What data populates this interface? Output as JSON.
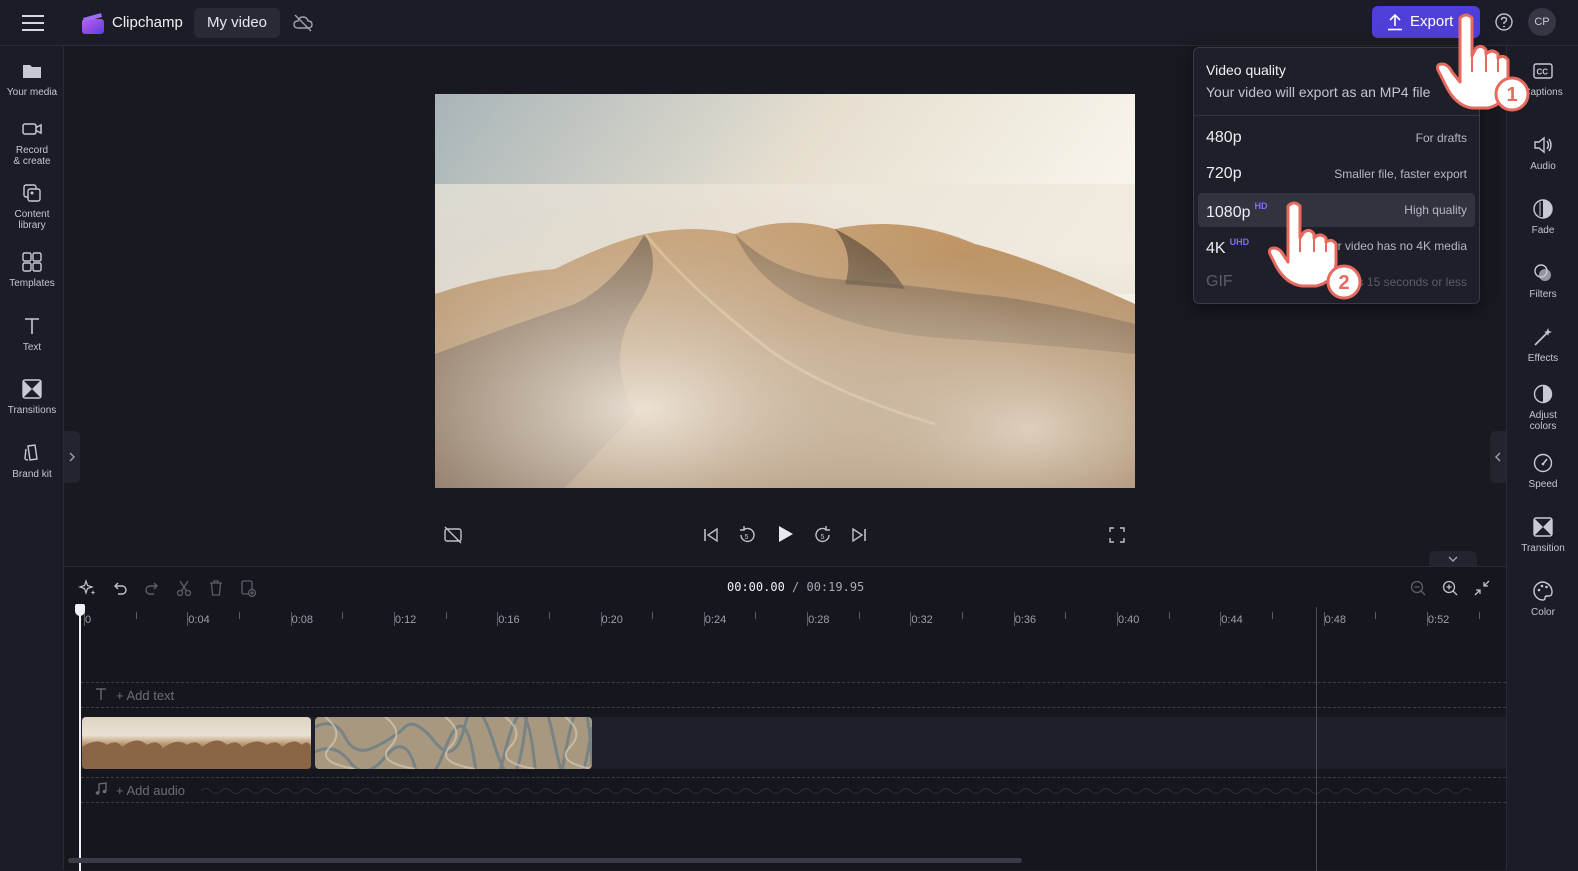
{
  "header": {
    "brand": "Clipchamp",
    "video_title": "My video",
    "export_label": "Export",
    "avatar_initials": "CP"
  },
  "left_sidebar": {
    "items": [
      {
        "label": "Your media",
        "icon": "folder-icon"
      },
      {
        "label": "Record & create",
        "icon": "camera-icon"
      },
      {
        "label": "Content library",
        "icon": "library-icon"
      },
      {
        "label": "Templates",
        "icon": "templates-icon"
      },
      {
        "label": "Text",
        "icon": "text-icon"
      },
      {
        "label": "Transitions",
        "icon": "transitions-icon"
      },
      {
        "label": "Brand kit",
        "icon": "brand-kit-icon"
      }
    ]
  },
  "right_sidebar": {
    "items": [
      {
        "label": "Captions",
        "icon": "captions-icon"
      },
      {
        "label": "Audio",
        "icon": "speaker-icon"
      },
      {
        "label": "Fade",
        "icon": "fade-icon"
      },
      {
        "label": "Filters",
        "icon": "filters-icon"
      },
      {
        "label": "Effects",
        "icon": "magic-wand-icon"
      },
      {
        "label": "Adjust colors",
        "icon": "contrast-icon"
      },
      {
        "label": "Speed",
        "icon": "speedometer-icon"
      },
      {
        "label": "Transition",
        "icon": "transition-icon"
      },
      {
        "label": "Color",
        "icon": "palette-icon"
      }
    ]
  },
  "export_menu": {
    "title": "Video quality",
    "subtitle": "Your video will export as an MP4 file",
    "options": [
      {
        "quality": "480p",
        "badge": "",
        "desc": "For drafts",
        "selected": false,
        "disabled": false
      },
      {
        "quality": "720p",
        "badge": "",
        "desc": "Smaller file, faster export",
        "selected": false,
        "disabled": false
      },
      {
        "quality": "1080p",
        "badge": "HD",
        "desc": "High quality",
        "selected": true,
        "disabled": false
      },
      {
        "quality": "4K",
        "badge": "UHD",
        "desc": "Your video has no 4K media",
        "selected": false,
        "disabled": false
      },
      {
        "quality": "GIF",
        "badge": "",
        "desc": "For videos 15 seconds or less",
        "selected": false,
        "disabled": true
      }
    ]
  },
  "annotations": {
    "step1": "1",
    "step2": "2"
  },
  "timeline": {
    "current_time": "00:00.00",
    "total_time": "/ 00:19.95",
    "ruler_labels": [
      "0",
      "0:04",
      "0:08",
      "0:12",
      "0:16",
      "0:20",
      "0:24",
      "0:28",
      "0:32",
      "0:36",
      "0:40",
      "0:44",
      "0:48",
      "0:52"
    ],
    "add_text_label": "+ Add text",
    "add_audio_label": "+ Add audio"
  },
  "colors": {
    "accent": "#4f3fd8",
    "badge": "#7b6cff",
    "annotation": "#e86a5e"
  }
}
